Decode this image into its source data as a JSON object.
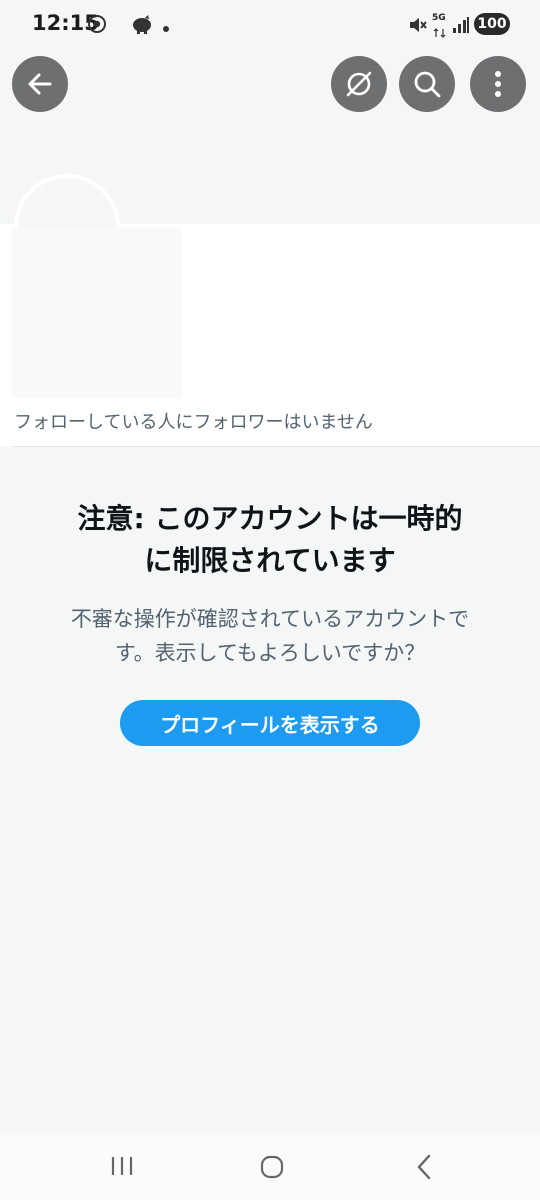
{
  "status_bar": {
    "time": "12:15",
    "network": "5G",
    "battery": "100"
  },
  "icons": {
    "back": "arrow-left-icon",
    "hide": "eye-slash-icon",
    "search": "search-icon",
    "more": "more-vertical-icon"
  },
  "profile": {
    "followers_note": "フォローしている人にフォロワーはいません"
  },
  "warning": {
    "title_line1": "注意: このアカウントは一時的",
    "title_line2": "に制限されています",
    "body_line1": "不審な操作が確認されているアカウントで",
    "body_line2": "す。表示してもよろしいですか？",
    "button_label": "プロフィールを表示する"
  },
  "colors": {
    "accent": "#1d9bf0",
    "header_buttons": "#6e6f70",
    "secondary_text": "#536471"
  }
}
